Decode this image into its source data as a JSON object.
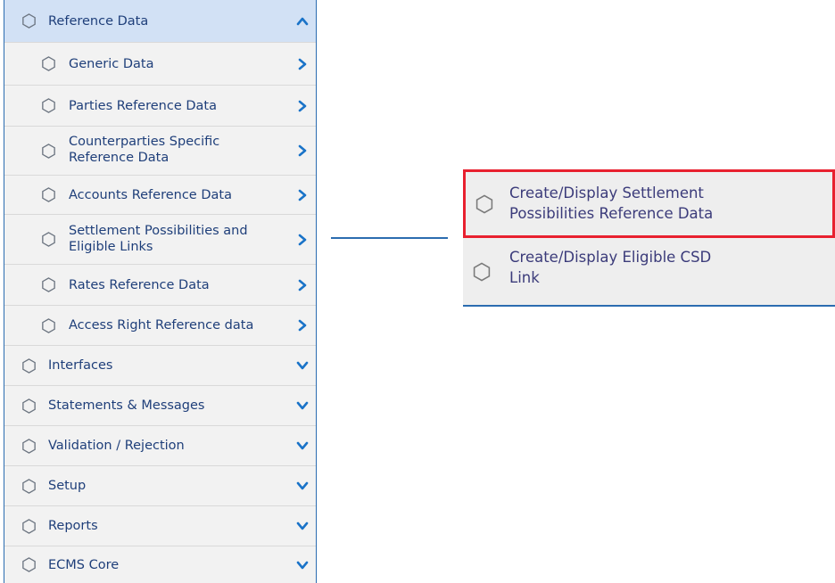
{
  "colors": {
    "menu_text": "#1f3f7a",
    "active_row_bg": "#d2e1f5",
    "chevron": "#1a73c8",
    "highlight_border": "#e8202f",
    "connector": "#2b6cb0"
  },
  "menu": {
    "reference_data": {
      "label": "Reference Data",
      "icon": "hexagon-outline-icon",
      "state": "expanded"
    },
    "sub_items": [
      {
        "label": "Generic Data"
      },
      {
        "label": "Parties Reference Data"
      },
      {
        "label": "Counterparties Specific Reference Data",
        "line1": "Counterparties Specific",
        "line2": "Reference Data"
      },
      {
        "label": "Accounts Reference Data"
      },
      {
        "label": "Settlement Possibilities and Eligible Links",
        "line1": "Settlement Possibilities and",
        "line2": "Eligible Links"
      },
      {
        "label": "Rates Reference Data"
      },
      {
        "label": "Access Right Reference data"
      }
    ],
    "top_items": [
      {
        "label": "Interfaces"
      },
      {
        "label": "Statements & Messages"
      },
      {
        "label": "Validation / Rejection"
      },
      {
        "label": "Setup"
      },
      {
        "label": "Reports"
      },
      {
        "label": "ECMS Core"
      }
    ]
  },
  "callout": {
    "items": [
      {
        "line1": "Create/Display Settlement",
        "line2": "Possibilities Reference Data",
        "highlighted": true
      },
      {
        "line1": "Create/Display Eligible CSD",
        "line2": "Link",
        "highlighted": false
      }
    ]
  }
}
